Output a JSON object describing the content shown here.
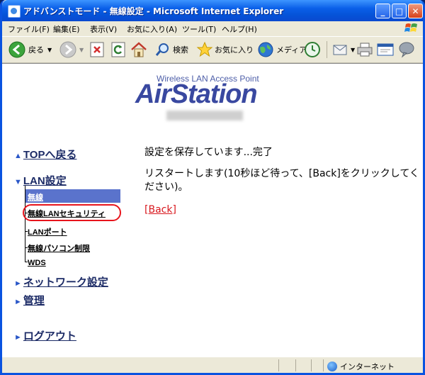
{
  "window": {
    "title": "アドバンストモード - 無線設定 - Microsoft Internet Explorer",
    "controls": {
      "minimize": "_",
      "maximize": "□",
      "close": "✕"
    }
  },
  "menu": [
    "ファイル(F)",
    "編集(E)",
    "表示(V)",
    "お気に入り(A)",
    "ツール(T)",
    "ヘルプ(H)"
  ],
  "toolbar": {
    "back_label": "戻る",
    "search_label": "検索",
    "favorites_label": "お気に入り",
    "media_label": "メディア"
  },
  "logo": {
    "subtitle": "Wireless LAN Access Point",
    "brand": "AirStation"
  },
  "sidebar": {
    "top_link": "TOPへ戻る",
    "lan_section": "LAN設定",
    "lan_items": [
      "無線",
      "無線LANセキュリティ",
      "LANポート",
      "無線パソコン制限",
      "WDS"
    ],
    "network_link": "ネットワーク設定",
    "admin_link": "管理",
    "logout_link": "ログアウト"
  },
  "main": {
    "saving_msg": "設定を保存しています...完了",
    "restart_msg": "リスタートします(10秒ほど待って、[Back]をクリックしてください)。",
    "back_link": "[Back]"
  },
  "statusbar": {
    "zone_label": "インターネット"
  },
  "colors": {
    "title_bar": "#0a5fe8",
    "active_nav_bg": "#5a73cc",
    "highlight_circle": "#e8141c",
    "link_red": "#d8181e",
    "brand_blue": "#3948a0"
  }
}
